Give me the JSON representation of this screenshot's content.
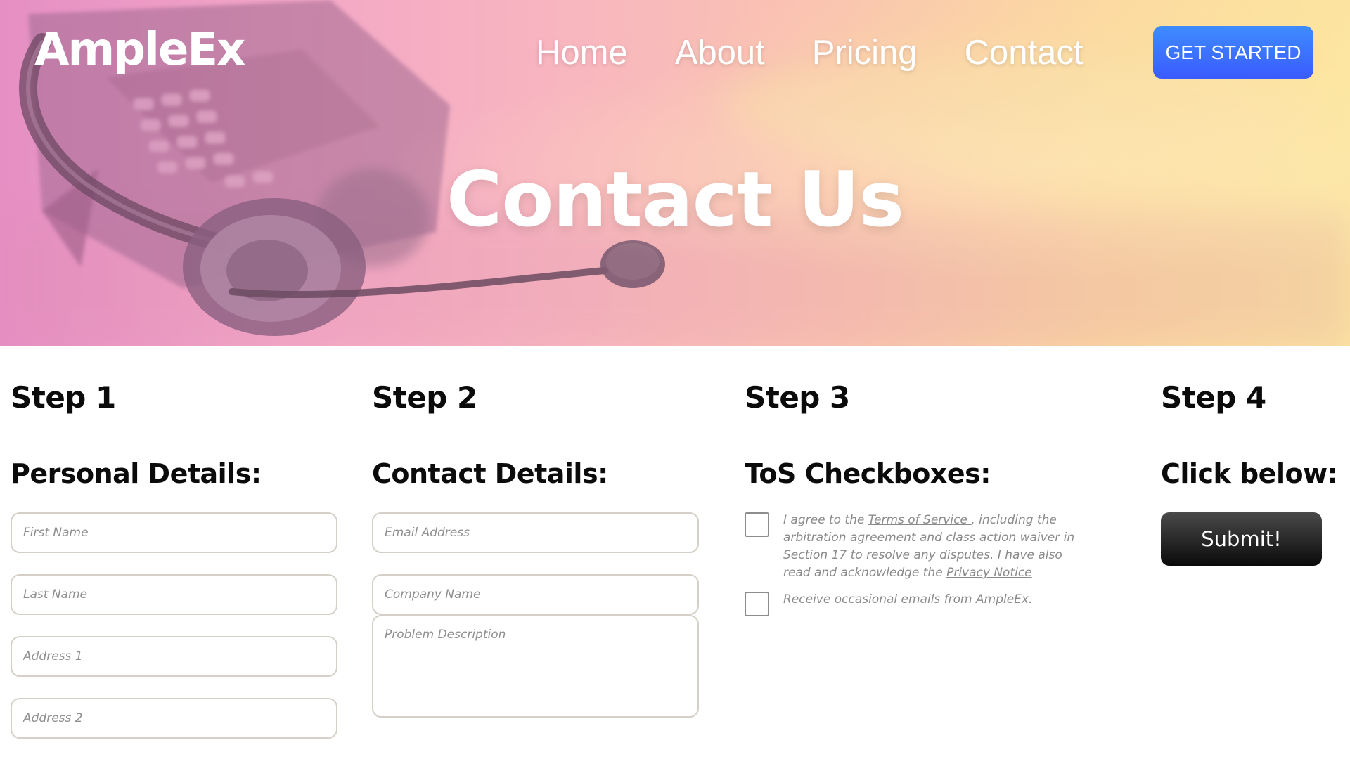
{
  "header": {
    "logo": "AmpleEx",
    "nav": [
      "Home",
      "About",
      "Pricing",
      "Contact"
    ],
    "cta_label": "GET STARTED"
  },
  "hero": {
    "title": "Contact Us",
    "image": "headset-and-desk-phone-photo"
  },
  "steps": [
    {
      "title": "Step 1",
      "section": "Personal Details:",
      "fields": [
        {
          "placeholder": "First Name",
          "value": ""
        },
        {
          "placeholder": "Last Name",
          "value": ""
        },
        {
          "placeholder": "Address 1",
          "value": ""
        },
        {
          "placeholder": "Address 2",
          "value": ""
        }
      ]
    },
    {
      "title": "Step 2",
      "section": "Contact Details:",
      "fields": [
        {
          "placeholder": "Email Address",
          "value": ""
        },
        {
          "placeholder": "Company Name",
          "value": ""
        },
        {
          "placeholder": "Problem Description",
          "value": ""
        }
      ]
    },
    {
      "title": "Step 3",
      "section": "ToS Checkboxes:",
      "checkboxes": [
        {
          "checked": false,
          "text_before": "I agree to the ",
          "link1": "Terms of Service ",
          "text_middle": ", including the arbitration agreement and class action waiver in Section 17 to resolve any disputes. I have also read and acknowledge the ",
          "link2": "Privacy Notice"
        },
        {
          "checked": false,
          "text": "Receive occasional emails from AmpleEx."
        }
      ]
    },
    {
      "title": "Step 4",
      "section": "Click below:",
      "submit_label": "Submit!"
    }
  ],
  "colors": {
    "hero_gradient_left": "#e58fc4",
    "hero_gradient_right": "#fbe3a0",
    "cta_button": "#3a6dff",
    "submit_button": "#111111",
    "field_border": "#d4d0c8"
  }
}
